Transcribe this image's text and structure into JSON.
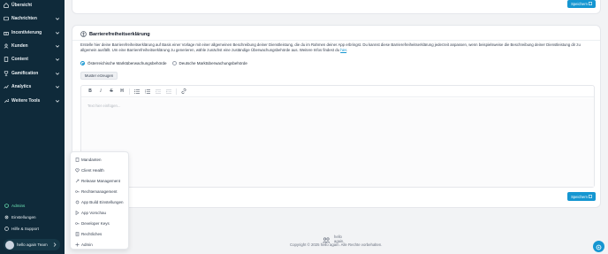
{
  "sidebar": {
    "items": [
      {
        "label": "Übersicht",
        "icon": "home-icon"
      },
      {
        "label": "Nachrichten",
        "icon": "message-icon"
      },
      {
        "label": "Incentivierung",
        "icon": "gift-icon"
      },
      {
        "label": "Kunden",
        "icon": "users-icon"
      },
      {
        "label": "Content",
        "icon": "file-icon"
      },
      {
        "label": "Gamification",
        "icon": "trophy-icon"
      },
      {
        "label": "Analytics",
        "icon": "chart-icon"
      },
      {
        "label": "Weitere Tools",
        "icon": "wrench-icon"
      }
    ],
    "bottom": [
      {
        "label": "Admins",
        "icon": "shield-icon"
      },
      {
        "label": "Einstellungen",
        "icon": "gear-icon"
      },
      {
        "label": "Hilfe & Support",
        "icon": "help-icon"
      }
    ],
    "user": {
      "name": "hello again Team"
    }
  },
  "toolbar_top": {
    "save_label": "Speichern"
  },
  "card": {
    "title": "Barrierefreiheitserklärung",
    "description": "Erstelle hier deine Barrierefreiheitserklärung auf Basis einer Vorlage mit einer allgemeinen Beschreibung deiner Dienstleistung, die du im Rahmen deiner App erbringst. Du kannst diese Barrierefreiheitserklärung jederzeit anpassen, wenn beispielsweise die Beschreibung deiner Dienstleistung dir zu allgemein ausfällt. Um eine Barrierefreiheitserklärung zu generieren, wähle zunächst eine zuständige Überwachungsbehörde aus. Weitere Infos findest du",
    "link_label": "hier",
    "radio": [
      {
        "label": "Österreichische Marktüberwachungsbehörde",
        "selected": true
      },
      {
        "label": "Deutsche Marktüberwachungsbehörde",
        "selected": false
      }
    ],
    "template_button": "Muster erzeugen",
    "editor_placeholder": "Text hier einfügen...",
    "save_label": "Speichern"
  },
  "menu": {
    "items": [
      {
        "label": "Mandanten",
        "icon": "building-icon"
      },
      {
        "label": "Client Health",
        "icon": "heart-icon"
      },
      {
        "label": "Release Management",
        "icon": "rocket-icon"
      },
      {
        "label": "Rechtemanagement",
        "icon": "key-icon"
      },
      {
        "label": "App Build Einstellungen",
        "icon": "gear-icon"
      },
      {
        "label": "App Vorschau",
        "icon": "play-icon"
      },
      {
        "label": "Developer Keys",
        "icon": "key-icon"
      },
      {
        "label": "Rechtliches",
        "icon": "document-icon"
      },
      {
        "label": "Admin",
        "icon": "plus-icon"
      }
    ]
  },
  "footer": {
    "logo_line1": "hello",
    "logo_line2": "again.",
    "copyright": "Copyright © 2025 hello again. Alle Rechte vorbehalten."
  },
  "colors": {
    "sidebar_bg": "#0f2a3a",
    "accent": "#1596d1",
    "admins_green": "#6ee7b7"
  }
}
